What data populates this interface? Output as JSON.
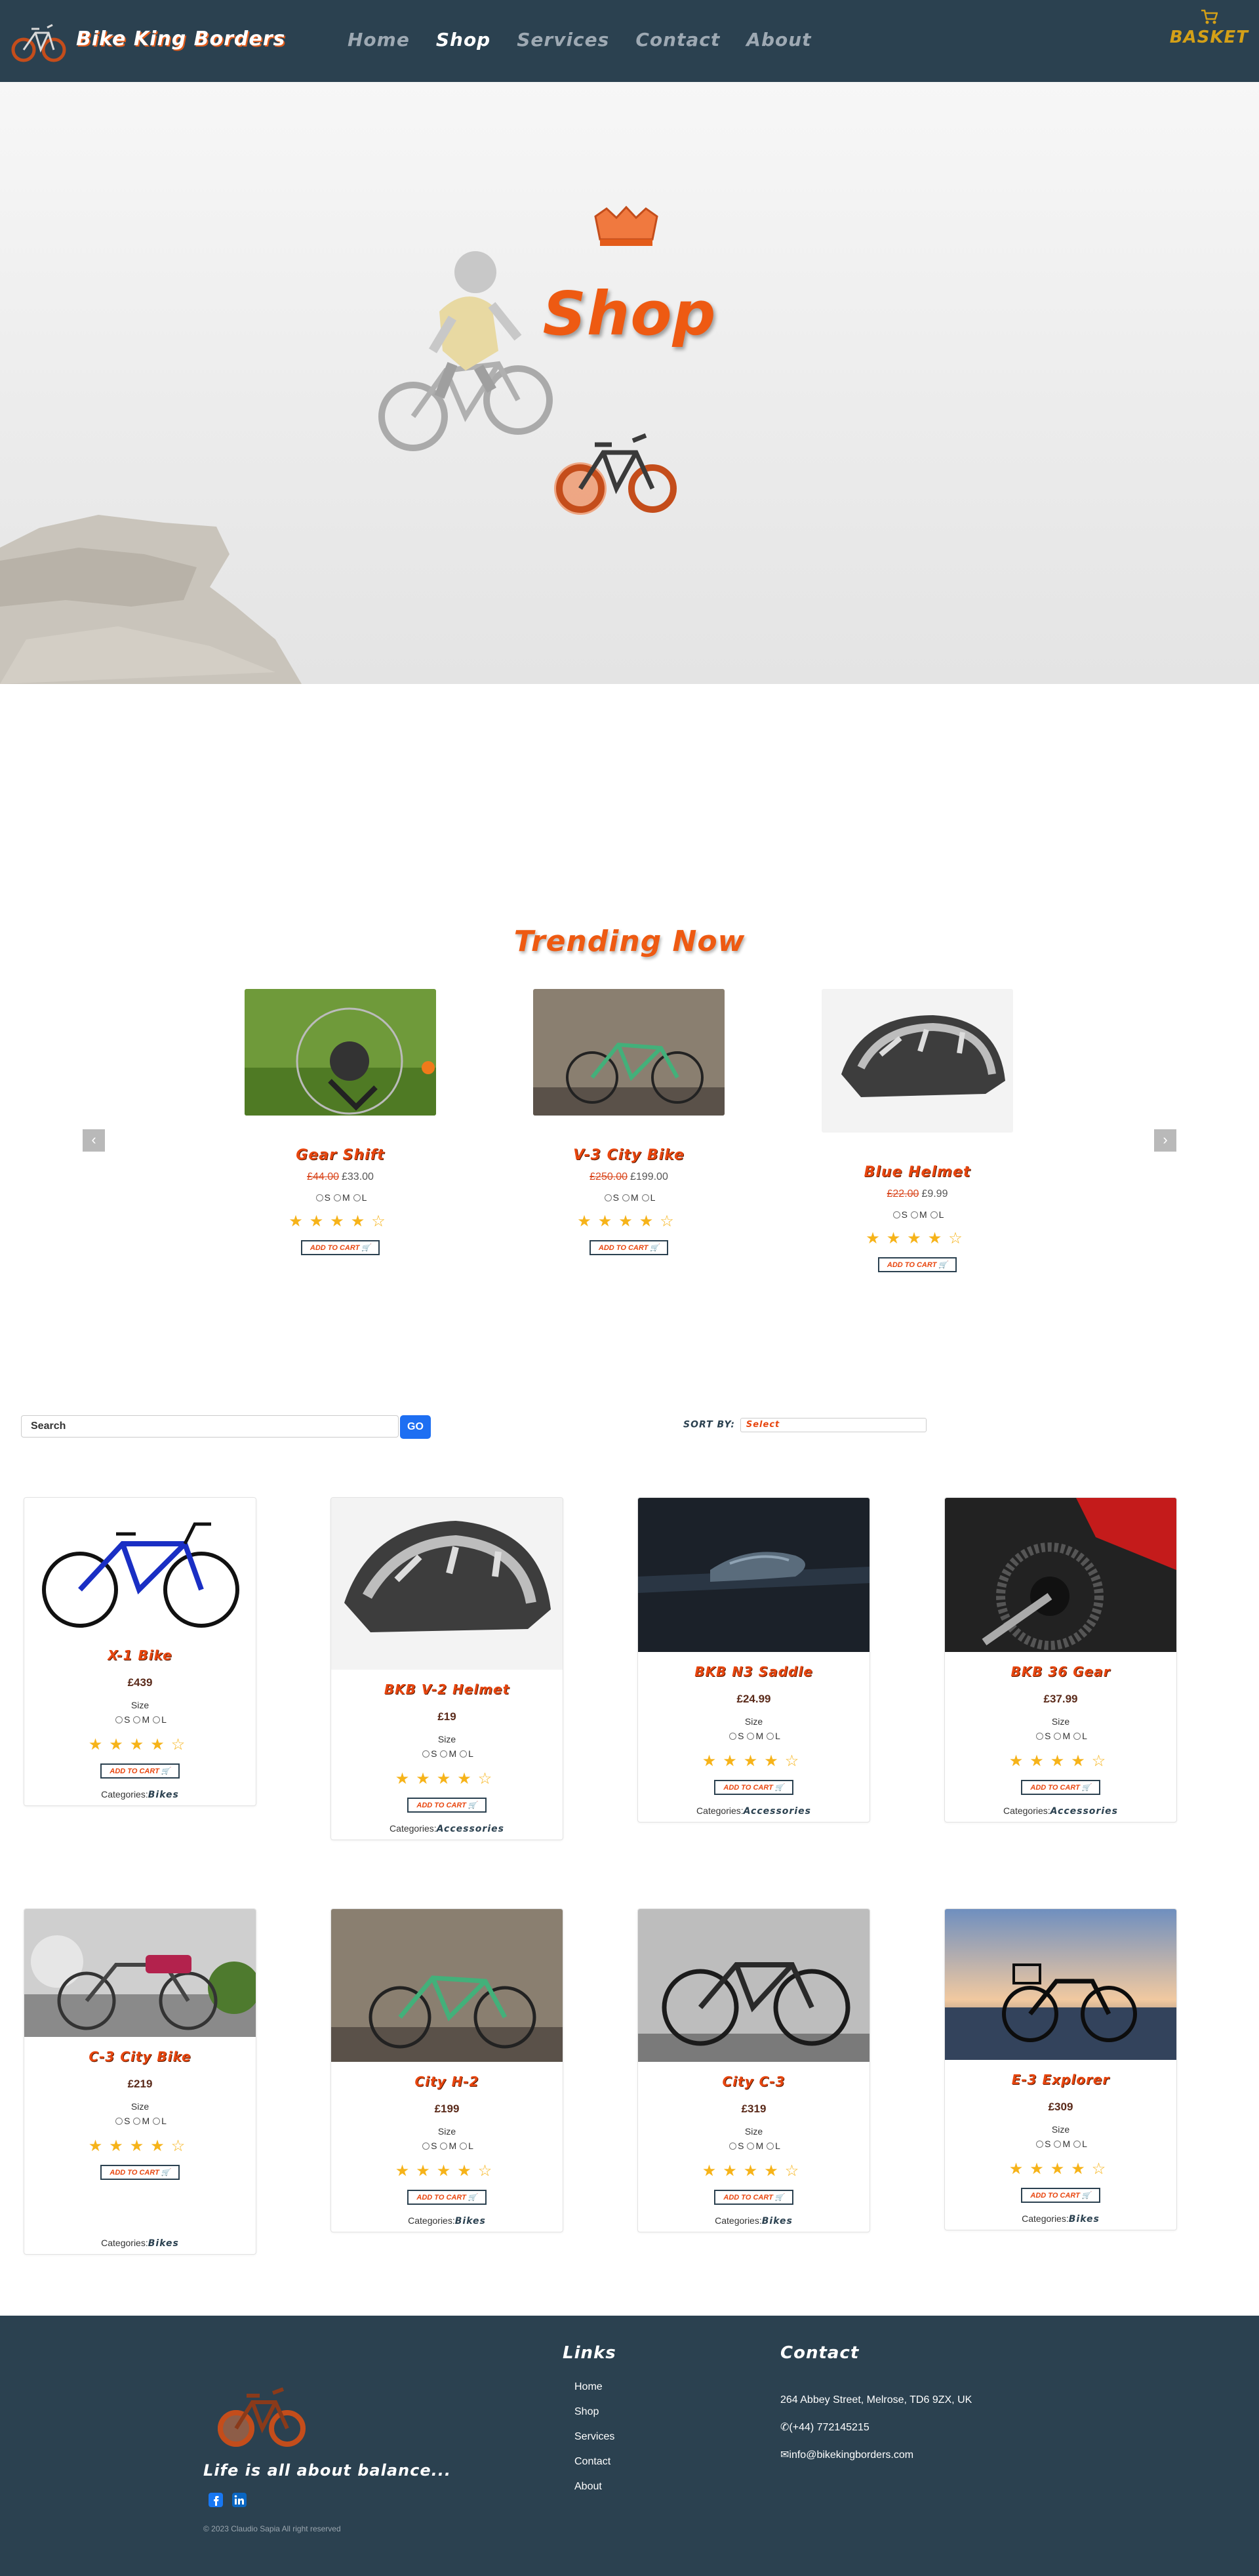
{
  "nav": {
    "brand": "Bike King Borders",
    "links": [
      "Home",
      "Shop",
      "Services",
      "Contact",
      "About"
    ],
    "active": "Shop",
    "basket_label": "BASKET"
  },
  "hero": {
    "title": "Shop"
  },
  "trending": {
    "title": "Trending Now",
    "items": [
      {
        "name": "Gear Shift",
        "old_price": "£44.00",
        "price": "£33.00",
        "rating": 4
      },
      {
        "name": "V-3 City Bike",
        "old_price": "£250.00",
        "price": "£199.00",
        "rating": 4
      },
      {
        "name": "Blue Helmet",
        "old_price": "£22.00",
        "price": "£9.99",
        "rating": 4
      }
    ]
  },
  "sizes": [
    "S",
    "M",
    "L"
  ],
  "add_to_cart": "ADD TO CART",
  "search": {
    "placeholder": "Search",
    "button": "GO"
  },
  "sort": {
    "label": "SORT BY:",
    "selected": "Select"
  },
  "size_label": "Size",
  "categories_label": "Categories:",
  "products": [
    {
      "name": "X-1 Bike",
      "price": "£439",
      "category": "Bikes",
      "rating": 4
    },
    {
      "name": "BKB V-2 Helmet",
      "price": "£19",
      "category": "Accessories",
      "rating": 4
    },
    {
      "name": "BKB N3 Saddle",
      "price": "£24.99",
      "category": "Accessories",
      "rating": 4
    },
    {
      "name": "BKB 36 Gear",
      "price": "£37.99",
      "category": "Accessories",
      "rating": 4
    },
    {
      "name": "C-3 City Bike",
      "price": "£219",
      "category": "Bikes",
      "rating": 4
    },
    {
      "name": "City H-2",
      "price": "£199",
      "category": "Bikes",
      "rating": 4
    },
    {
      "name": "City C-3",
      "price": "£319",
      "category": "Bikes",
      "rating": 4
    },
    {
      "name": "E-3 Explorer",
      "price": "£309",
      "category": "Bikes",
      "rating": 4
    }
  ],
  "footer": {
    "tagline": "Life is all about balance...",
    "copyright": "© 2023 Claudio Sapia All right reserved",
    "links_title": "Links",
    "links": [
      "Home",
      "Shop",
      "Services",
      "Contact",
      "About"
    ],
    "contact_title": "Contact",
    "address": "264 Abbey Street, Melrose, TD6 9ZX, UK",
    "phone": "(+44) 772145215",
    "email": "info@bikekingborders.com"
  },
  "colors": {
    "nav_bg": "#2b4150",
    "accent": "#ee5a12",
    "star": "#f6b319",
    "basket": "#d4a017",
    "go_button": "#1e6ff2"
  }
}
